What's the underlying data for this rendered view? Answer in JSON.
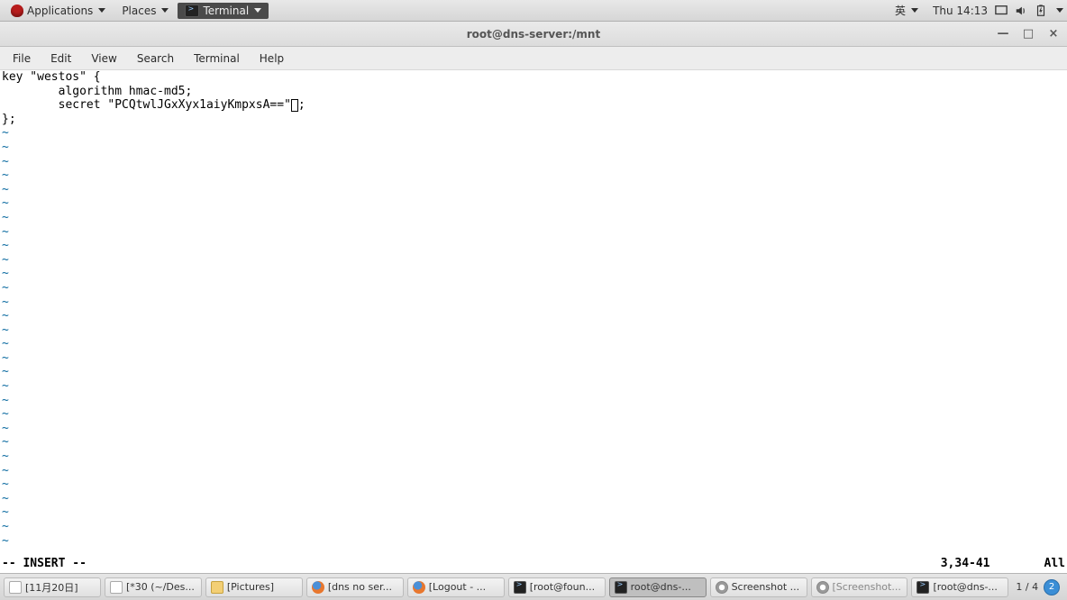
{
  "top_panel": {
    "applications_label": "Applications",
    "places_label": "Places",
    "terminal_label": "Terminal",
    "ime_label": "英",
    "clock": "Thu 14:13"
  },
  "window": {
    "title": "root@dns-server:/mnt",
    "minimize": "—",
    "maximize": "□",
    "close": "×"
  },
  "menubar": {
    "file": "File",
    "edit": "Edit",
    "view": "View",
    "search": "Search",
    "terminal": "Terminal",
    "help": "Help"
  },
  "editor": {
    "lines": [
      "key \"westos\" {",
      "        algorithm hmac-md5;",
      "        secret \"PCQtwlJGxXyx1aiyKmpxsA==\";",
      "};"
    ],
    "tilde": "~",
    "cursor_line_index": 2,
    "cursor_col": 41,
    "mode": "-- INSERT --",
    "position": "3,34-41",
    "scroll": "All"
  },
  "taskbar": {
    "items": [
      {
        "label": "[11月20日]",
        "icon": "text",
        "active": false,
        "dimmed": false
      },
      {
        "label": "[*30 (~/Des...",
        "icon": "text",
        "active": false,
        "dimmed": false
      },
      {
        "label": "[Pictures]",
        "icon": "folder",
        "active": false,
        "dimmed": false
      },
      {
        "label": "[dns no ser...",
        "icon": "ff",
        "active": false,
        "dimmed": false
      },
      {
        "label": "[Logout - ...",
        "icon": "ff",
        "active": false,
        "dimmed": false
      },
      {
        "label": "[root@foun...",
        "icon": "term",
        "active": false,
        "dimmed": false
      },
      {
        "label": "root@dns-...",
        "icon": "term",
        "active": true,
        "dimmed": false
      },
      {
        "label": "Screenshot ...",
        "icon": "lens",
        "active": false,
        "dimmed": false
      },
      {
        "label": "[Screenshot...",
        "icon": "lens",
        "active": false,
        "dimmed": true
      },
      {
        "label": "[root@dns-...",
        "icon": "term",
        "active": false,
        "dimmed": false
      }
    ],
    "workspace": "1 / 4",
    "badge": "2"
  }
}
